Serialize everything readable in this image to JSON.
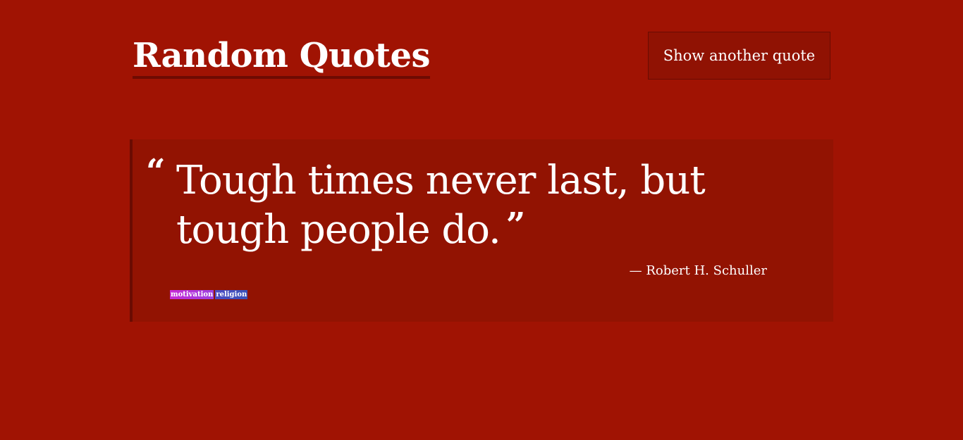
{
  "header": {
    "title": "Random Quotes",
    "new_quote_label": "Show another quote"
  },
  "quote": {
    "open_mark": "“",
    "text": "Tough times never last, but tough people do.",
    "close_mark": "”",
    "author": "— Robert H. Schuller",
    "tags": [
      {
        "label": "motivation",
        "color": "#c62ad6"
      },
      {
        "label": "religion",
        "color": "#4a4bc4"
      }
    ]
  },
  "colors": {
    "background": "#a01303",
    "card": "#921302",
    "accent": "#6a0b02"
  }
}
